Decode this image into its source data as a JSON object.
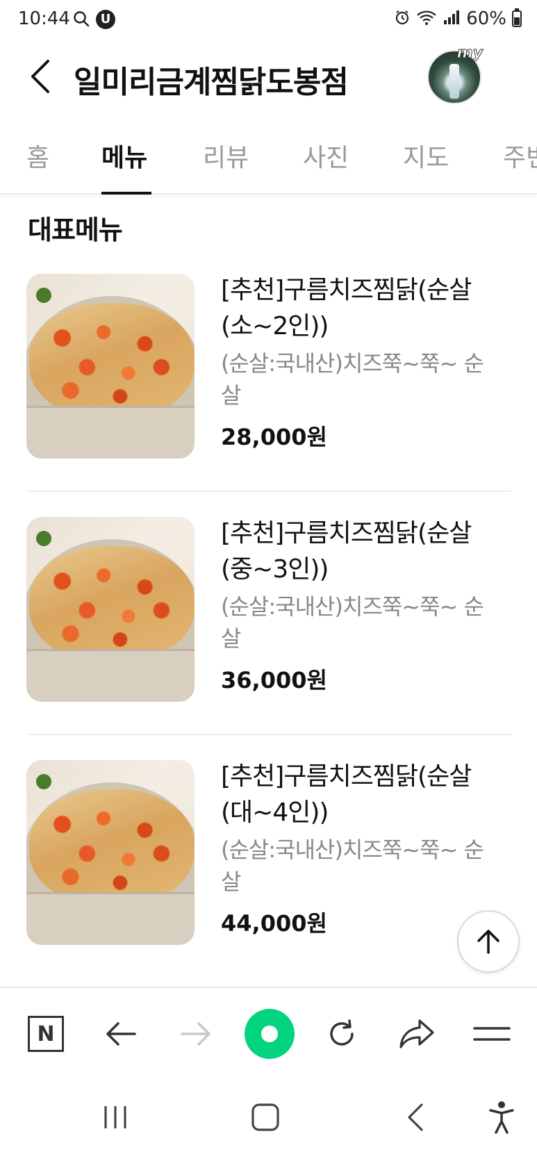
{
  "status_bar": {
    "time": "10:44",
    "u_badge": "U",
    "battery": "60%"
  },
  "header": {
    "title": "일미리금계찜닭도봉점",
    "avatar_tag": "my"
  },
  "tabs": [
    {
      "label": "홈"
    },
    {
      "label": "메뉴"
    },
    {
      "label": "리뷰"
    },
    {
      "label": "사진"
    },
    {
      "label": "지도"
    },
    {
      "label": "주변"
    }
  ],
  "section": {
    "title": "대표메뉴"
  },
  "menu_items": [
    {
      "name": "[추천]구름치즈찜닭(순살(소~2인))",
      "description": "(순살:국내산)치즈쭉~쭉~ 순살",
      "price": "28,000원"
    },
    {
      "name": "[추천]구름치즈찜닭(순살(중~3인))",
      "description": "(순살:국내산)치즈쭉~쭉~ 순살",
      "price": "36,000원"
    },
    {
      "name": "[추천]구름치즈찜닭(순살(대~4인))",
      "description": "(순살:국내산)치즈쭉~쭉~ 순살",
      "price": "44,000원"
    }
  ],
  "browser_bar": {
    "home_letter": "N",
    "icons": [
      "naver-home-icon",
      "back-arrow-icon",
      "forward-arrow-icon",
      "green-dot-icon",
      "refresh-icon",
      "share-icon",
      "menu-icon"
    ]
  },
  "colors": {
    "accent_green": "#03d37c",
    "text_primary": "#111111",
    "text_secondary": "#888888",
    "tab_inactive": "#999999"
  }
}
